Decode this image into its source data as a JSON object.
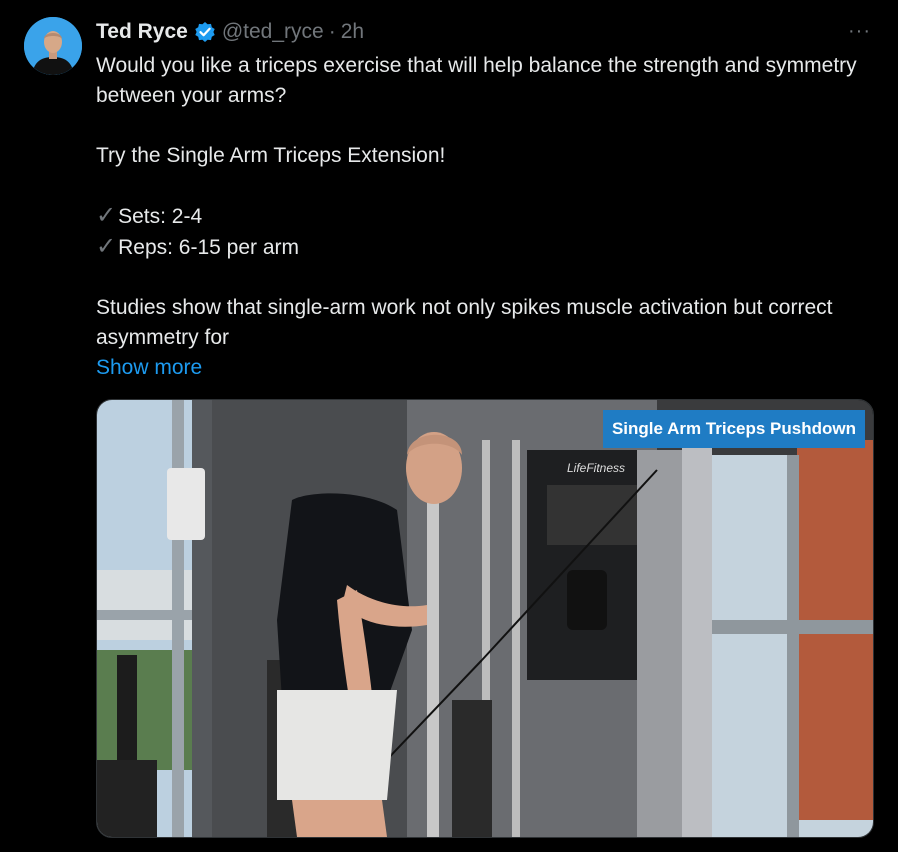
{
  "tweet": {
    "author_name": "Ted Ryce",
    "handle": "@ted_ryce",
    "separator": "·",
    "time": "2h",
    "more_label": "···",
    "text_line1": "Would you like a triceps exercise that will help balance the strength and symmetry between your arms?",
    "text_line2": "Try the Single Arm Triceps Extension!",
    "check_glyph": "✓",
    "bullet1": "Sets: 2-4",
    "bullet2": "Reps: 6-15 per arm",
    "text_line3": "Studies show that single-arm work not only spikes muscle activation but correct asymmetry for",
    "show_more": "Show more"
  },
  "media": {
    "overlay_label": "Single Arm Triceps Pushdown",
    "machine_brand": "LifeFitness"
  },
  "icons": {
    "verified": "verified-badge-icon",
    "more": "more-options-icon"
  },
  "colors": {
    "background": "#000000",
    "text": "#e7e9ea",
    "muted": "#71767b",
    "link": "#1d9bf0",
    "overlay": "#1f7cc4"
  }
}
